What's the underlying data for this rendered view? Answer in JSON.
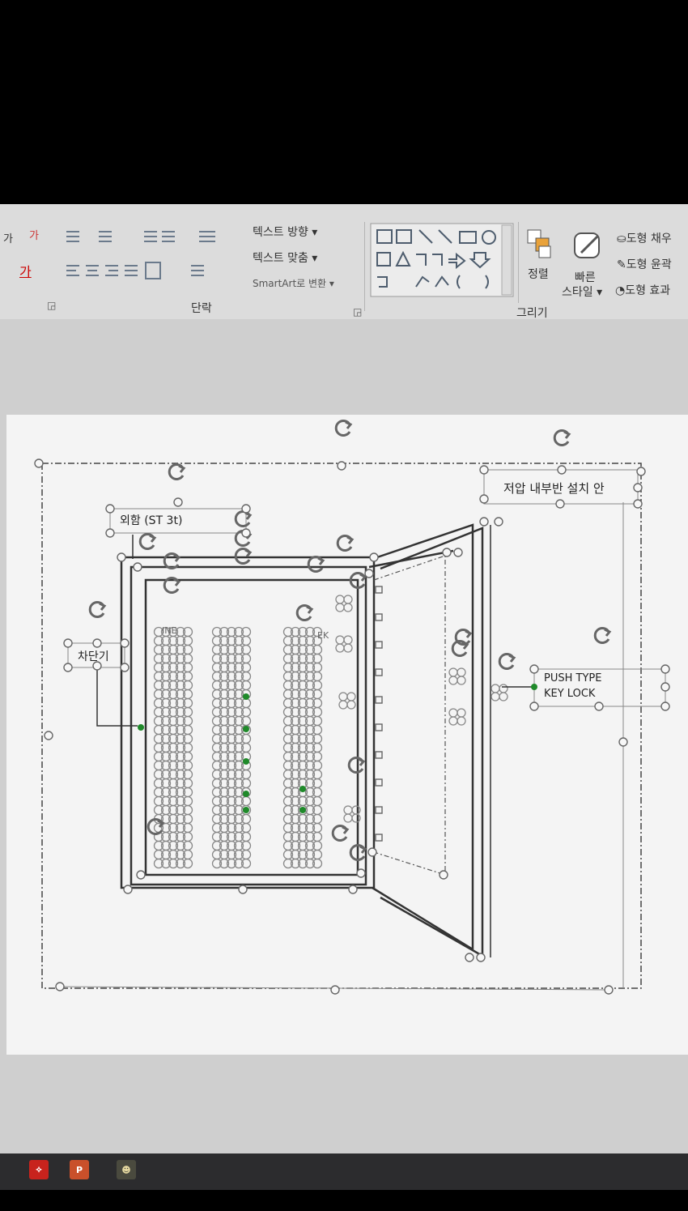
{
  "ribbon": {
    "text_direction_label": "텍스트 방향 ▾",
    "text_align_label": "텍스트 맞춤 ▾",
    "smartart_label": "SmartArt로 변환 ▾",
    "paragraph_group": "단락",
    "arrange_label": "정렬",
    "quick_styles_label_1": "빠른",
    "quick_styles_label_2": "스타일 ▾",
    "shape_fill_label": "도형 채우",
    "shape_outline_label": "도형 윤곽",
    "shape_effects_label": "도형 효과",
    "drawing_group": "그리기",
    "font_btn_1": "가",
    "font_btn_2": "가"
  },
  "slide": {
    "label_exterior": "외함 (ST 3t)",
    "label_breaker": "차단기",
    "label_install": "저압 내부반 설치 안",
    "label_keylock_1": "PUSH TYPE",
    "label_keylock_2": "KEY LOCK",
    "label_partial_1": "INE",
    "label_partial_2": "EK"
  },
  "taskbar": {
    "pdf_icon": "pdf-icon",
    "ppt_icon": "powerpoint-icon",
    "app_icon": "app-icon",
    "ppt_text": "P"
  },
  "colors": {
    "ribbon_bg": "#dcdcdc",
    "slide_bg": "#f4f4f4",
    "selection_handle": "#777777",
    "green_handle": "#1f8a2a"
  }
}
